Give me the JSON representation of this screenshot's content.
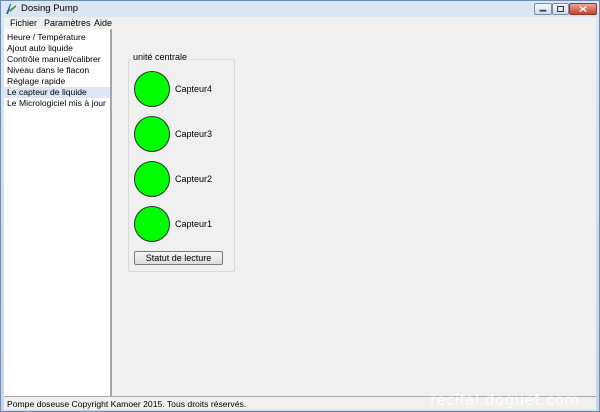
{
  "window": {
    "title": "Dosing Pump"
  },
  "menu": [
    "Fichier",
    "Paramètres",
    "Aide"
  ],
  "sidebar": {
    "items": [
      {
        "label": "Heure / Température",
        "selected": false
      },
      {
        "label": "Ajout auto liquide",
        "selected": false
      },
      {
        "label": "Contrôle manuel/calibrer",
        "selected": false
      },
      {
        "label": "Niveau dans le flacon",
        "selected": false
      },
      {
        "label": "Réglage rapide",
        "selected": false
      },
      {
        "label": "Le capteur de liquide",
        "selected": true
      },
      {
        "label": "Le Micrologiciel mis à jour",
        "selected": false
      }
    ]
  },
  "panel": {
    "group_title": "unité centrale",
    "sensors": [
      {
        "label": "Capteur4",
        "status_color": "#00ff00"
      },
      {
        "label": "Capteur3",
        "status_color": "#00ff00"
      },
      {
        "label": "Capteur2",
        "status_color": "#00ff00"
      },
      {
        "label": "Capteur1",
        "status_color": "#00ff00"
      }
    ],
    "read_button_label": "Statut de lecture"
  },
  "status_bar": {
    "text": "Pompe doseuse Copyright Kamoer 2015. Tous droits réservés."
  },
  "watermark": "recifal.doguet.com"
}
